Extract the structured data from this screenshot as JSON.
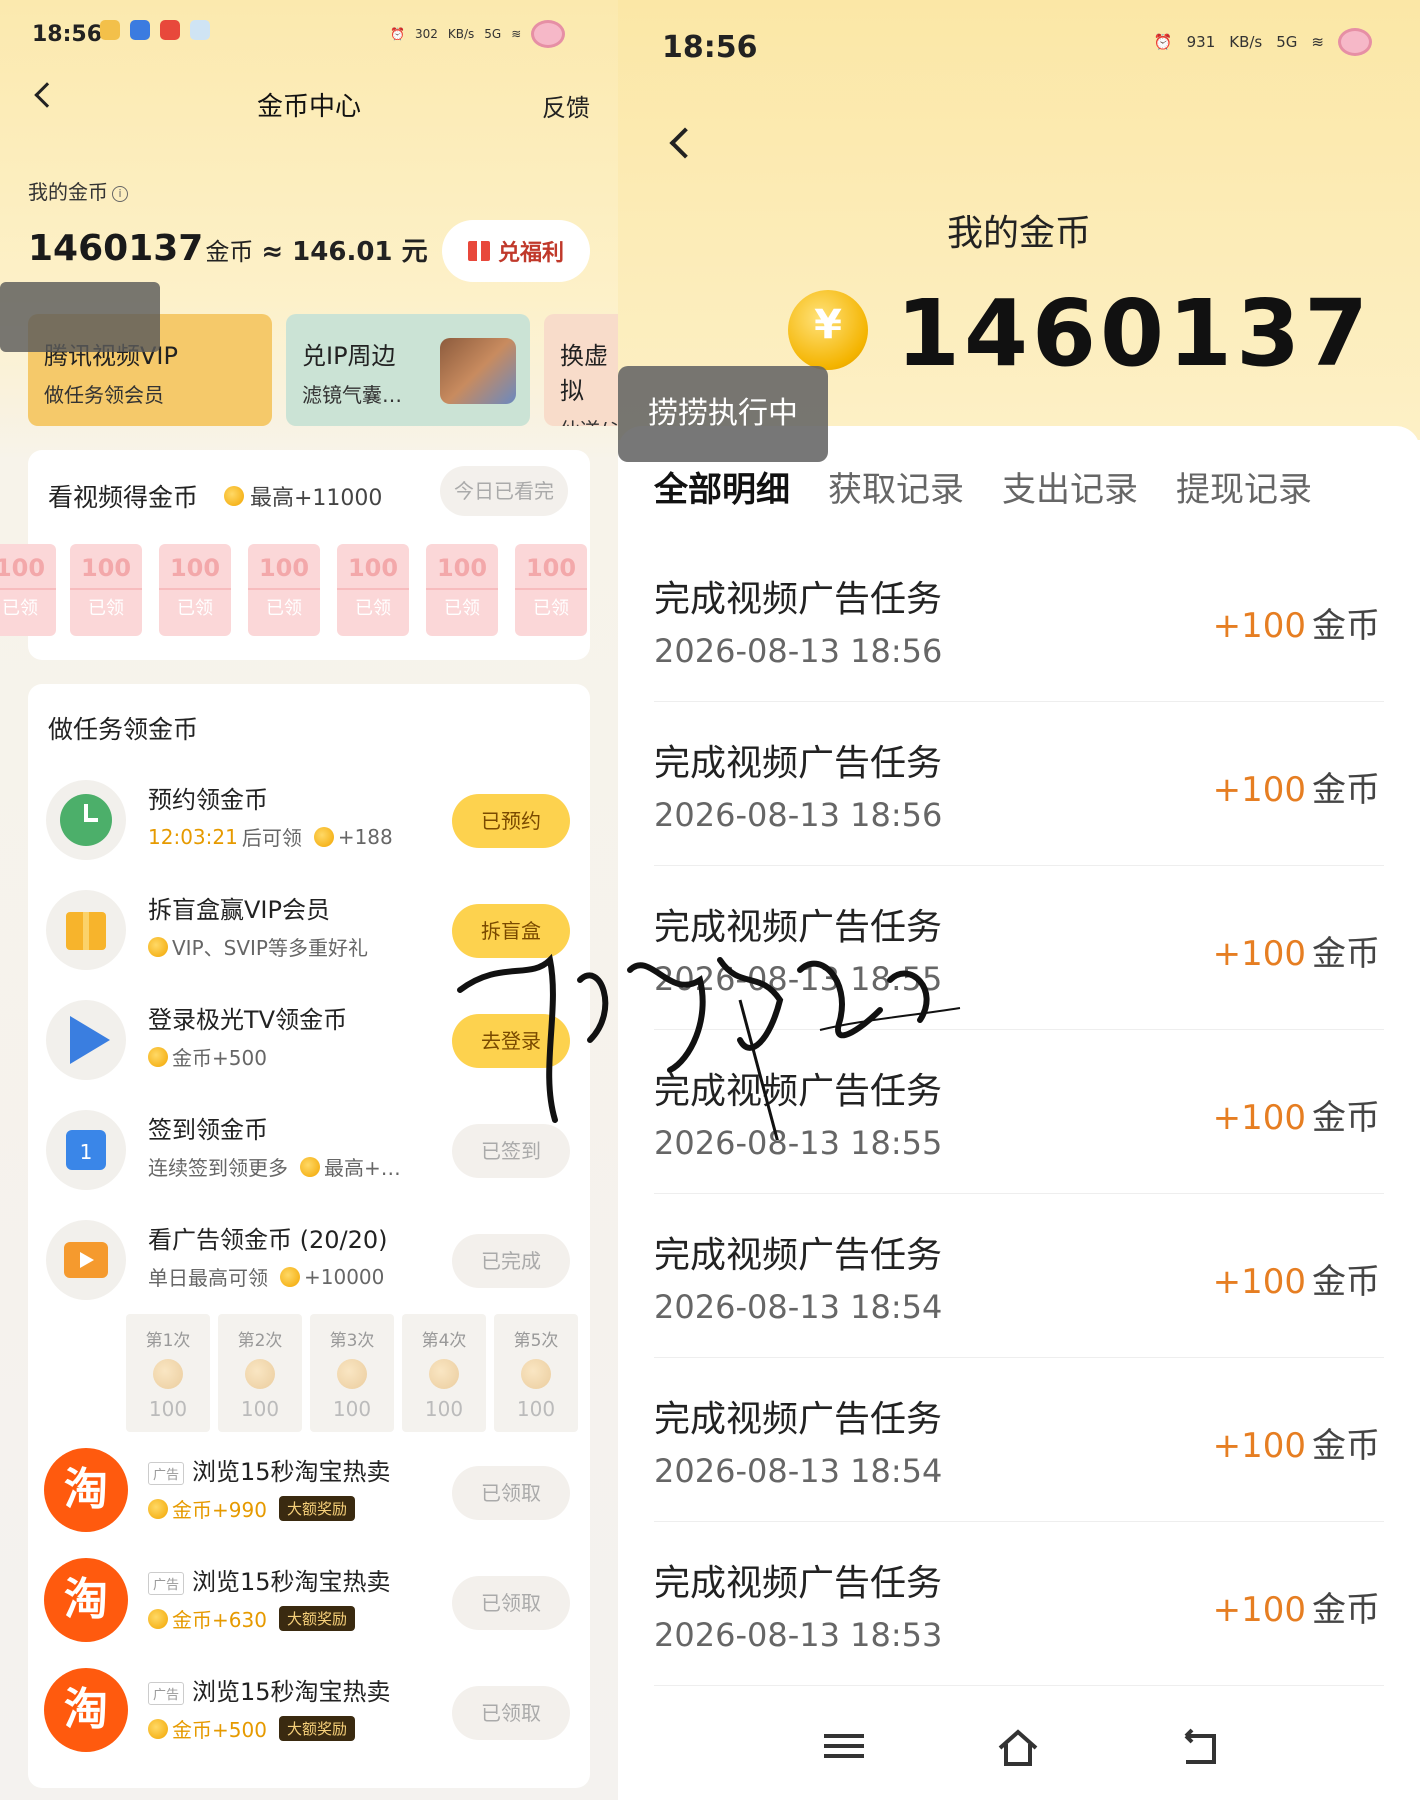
{
  "left": {
    "status": {
      "time": "18:56",
      "net_speed": "302",
      "net_unit": "KB/s",
      "signal": "5G"
    },
    "nav": {
      "title": "金币中心",
      "feedback": "反馈"
    },
    "balance": {
      "label": "我的金币",
      "info_glyph": "i",
      "coins": "1460137",
      "coin_unit": "金币",
      "approx": "≈ 146.01 元",
      "redeem": "兑福利"
    },
    "promos": [
      {
        "title": "腾讯视频VIP",
        "sub": "做任务领会员"
      },
      {
        "title": "兑IP周边",
        "sub": "滤镜气囊…"
      },
      {
        "title": "换虚拟",
        "sub": "仙逆/斗"
      }
    ],
    "watch": {
      "title": "看视频得金币",
      "max": "最高+11000",
      "status": "今日已看完",
      "envelopes": [
        {
          "value": "100",
          "state": "已领"
        },
        {
          "value": "100",
          "state": "已领"
        },
        {
          "value": "100",
          "state": "已领"
        },
        {
          "value": "100",
          "state": "已领"
        },
        {
          "value": "100",
          "state": "已领"
        },
        {
          "value": "100",
          "state": "已领"
        }
      ]
    },
    "tasks": {
      "title": "做任务领金币",
      "items": [
        {
          "name": "预约领金币",
          "countdown": "12:03:21",
          "sub": "后可领",
          "reward": "+188",
          "button": "已预约",
          "icon": "clock-icon"
        },
        {
          "name": "拆盲盒赢VIP会员",
          "sub": "VIP、SVIP等多重好礼",
          "button": "拆盲盒",
          "icon": "gift-box-icon"
        },
        {
          "name": "登录极光TV领金币",
          "sub": "金币+500",
          "button": "去登录",
          "icon": "play-icon"
        },
        {
          "name": "签到领金币",
          "sub": "连续签到领更多",
          "reward": "最高+…",
          "button": "已签到",
          "icon": "calendar-icon",
          "cal_day": "1"
        },
        {
          "name": "看广告领金币 (20/20)",
          "sub": "单日最高可领",
          "reward": "+10000",
          "button": "已完成",
          "icon": "ad-play-icon"
        }
      ],
      "steps": [
        {
          "label": "第1次",
          "value": "100"
        },
        {
          "label": "第2次",
          "value": "100"
        },
        {
          "label": "第3次",
          "value": "100"
        },
        {
          "label": "第4次",
          "value": "100"
        },
        {
          "label": "第5次",
          "value": "100"
        }
      ],
      "taobao": [
        {
          "ad": "广告",
          "name": "浏览15秒淘宝热卖",
          "reward": "金币+990",
          "tag": "大额奖励",
          "button": "已领取",
          "icon_char": "淘"
        },
        {
          "ad": "广告",
          "name": "浏览15秒淘宝热卖",
          "reward": "金币+630",
          "tag": "大额奖励",
          "button": "已领取",
          "icon_char": "淘"
        },
        {
          "ad": "广告",
          "name": "浏览15秒淘宝热卖",
          "reward": "金币+500",
          "tag": "大额奖励",
          "button": "已领取",
          "icon_char": "淘"
        }
      ]
    }
  },
  "right": {
    "status": {
      "time": "18:56",
      "net_speed": "931",
      "net_unit": "KB/s",
      "signal": "5G"
    },
    "title": "我的金币",
    "coins": "1460137",
    "toast": "捞捞执行中",
    "tabs": [
      "全部明细",
      "获取记录",
      "支出记录",
      "提现记录"
    ],
    "records": [
      {
        "name": "完成视频广告任务",
        "time": "2026-08-13 18:56",
        "amount": "+100",
        "unit": "金币"
      },
      {
        "name": "完成视频广告任务",
        "time": "2026-08-13 18:56",
        "amount": "+100",
        "unit": "金币"
      },
      {
        "name": "完成视频广告任务",
        "time": "2026-08-13 18:55",
        "amount": "+100",
        "unit": "金币"
      },
      {
        "name": "完成视频广告任务",
        "time": "2026-08-13 18:55",
        "amount": "+100",
        "unit": "金币"
      },
      {
        "name": "完成视频广告任务",
        "time": "2026-08-13 18:54",
        "amount": "+100",
        "unit": "金币"
      },
      {
        "name": "完成视频广告任务",
        "time": "2026-08-13 18:54",
        "amount": "+100",
        "unit": "金币"
      },
      {
        "name": "完成视频广告任务",
        "time": "2026-08-13 18:53",
        "amount": "+100",
        "unit": "金币"
      }
    ]
  },
  "colors": {
    "accent_yellow": "#fdd24e",
    "amount_orange": "#e67e22",
    "taobao_orange": "#ff5a0e"
  }
}
